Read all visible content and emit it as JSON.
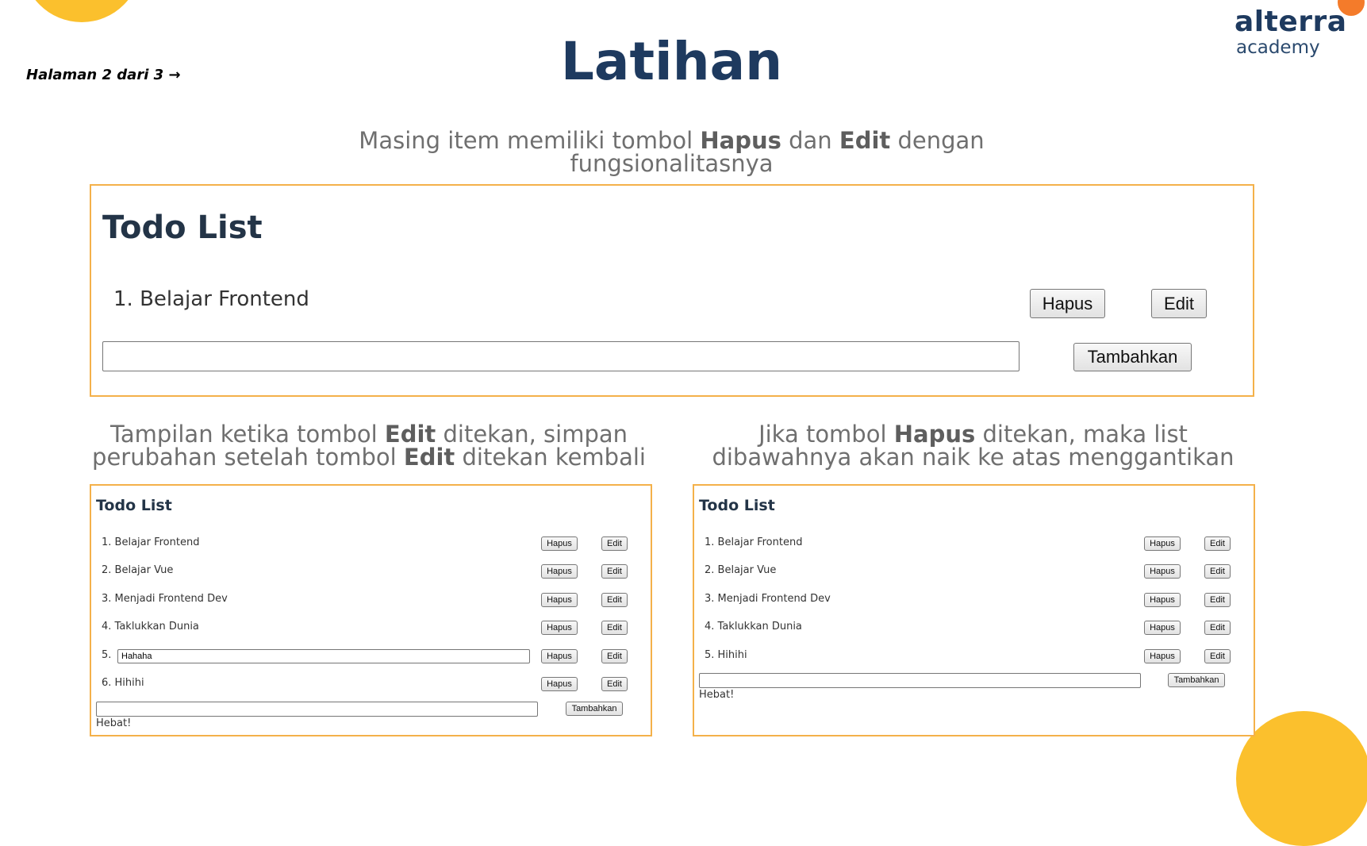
{
  "header": {
    "page_indicator": "Halaman 2 dari 3 →",
    "title": "Latihan",
    "logo": {
      "main": "alterra",
      "sub": "academy"
    }
  },
  "captions": {
    "main": {
      "pre": "Masing item memiliki tombol ",
      "b1": "Hapus",
      "mid": " dan ",
      "b2": "Edit",
      "post": " dengan fungsionalitasnya"
    },
    "left": {
      "pre": "Tampilan ketika tombol ",
      "b1": "Edit",
      "mid": " ditekan, simpan perubahan setelah tombol ",
      "b2": "Edit",
      "post": " ditekan kembali"
    },
    "right": {
      "pre": "Jika tombol ",
      "b1": "Hapus",
      "post": " ditekan, maka list dibawahnya akan naik ke atas menggantikan"
    }
  },
  "main_panel": {
    "title": "Todo List",
    "item": "1. Belajar Frontend",
    "hapus_label": "Hapus",
    "edit_label": "Edit",
    "input_value": "",
    "add_label": "Tambahkan"
  },
  "left_panel": {
    "title": "Todo List",
    "items": [
      {
        "text": "1. Belajar Frontend"
      },
      {
        "text": "2. Belajar Vue"
      },
      {
        "text": "3. Menjadi Frontend Dev"
      },
      {
        "text": "4. Taklukkan Dunia"
      },
      {
        "text": "5.",
        "edit_value": "Hahaha"
      },
      {
        "text": "6. Hihihi"
      }
    ],
    "hapus_label": "Hapus",
    "edit_label": "Edit",
    "add_label": "Tambahkan",
    "message": "Hebat!"
  },
  "right_panel": {
    "title": "Todo List",
    "items": [
      {
        "text": "1. Belajar Frontend"
      },
      {
        "text": "2. Belajar Vue"
      },
      {
        "text": "3. Menjadi Frontend Dev"
      },
      {
        "text": "4. Taklukkan Dunia"
      },
      {
        "text": "5. Hihihi"
      }
    ],
    "hapus_label": "Hapus",
    "edit_label": "Edit",
    "add_label": "Tambahkan",
    "message": "Hebat!"
  },
  "colors": {
    "accent": "#fbc02d",
    "panel_border": "#f4b14a",
    "title_navy": "#1e3a5f",
    "logo_dot": "#f47b2a"
  }
}
